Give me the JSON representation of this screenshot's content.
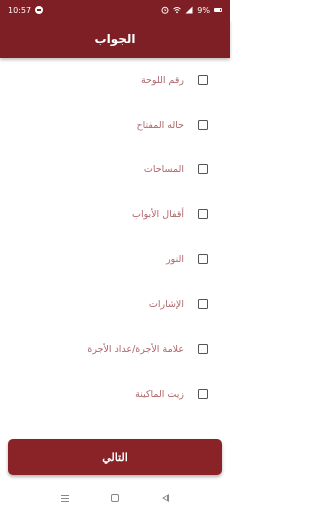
{
  "status_bar": {
    "time": "10:57",
    "battery": "9%"
  },
  "app_bar": {
    "title": "الجواب"
  },
  "items": [
    {
      "label": "رقم اللوحة"
    },
    {
      "label": "حاله المفتاح"
    },
    {
      "label": "المساحات"
    },
    {
      "label": "أقفال الأبواب"
    },
    {
      "label": "النور"
    },
    {
      "label": "الإشارات"
    },
    {
      "label": "علامة الأجرة/عداد الأجرة"
    },
    {
      "label": "زيت الماكينة"
    }
  ],
  "next_button": {
    "label": "التالي"
  },
  "colors": {
    "primary": "#7d1f24",
    "button": "#8a2328",
    "label_text": "#b0666a",
    "checkbox_border": "#555555"
  }
}
